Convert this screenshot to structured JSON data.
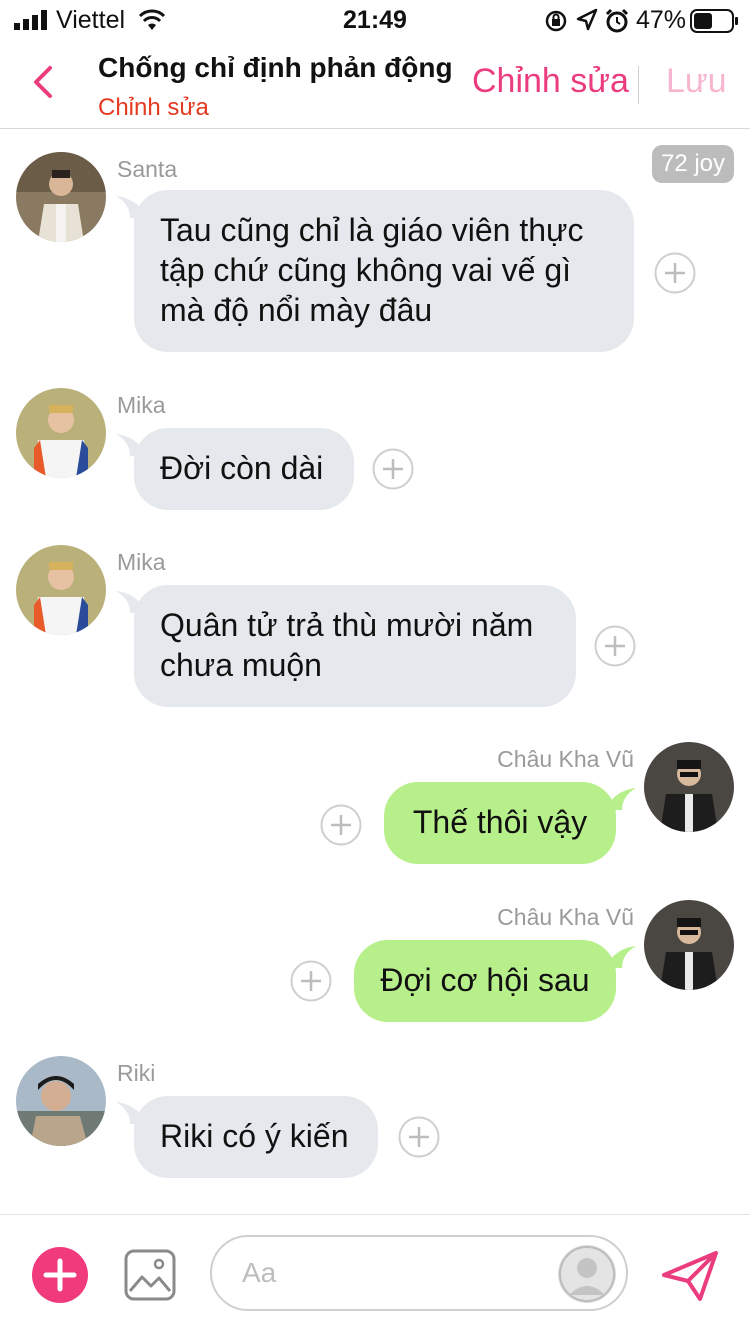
{
  "status_bar": {
    "carrier": "Viettel",
    "time": "21:49",
    "battery_percent": "47%"
  },
  "header": {
    "title": "Chống chỉ định phản động",
    "subtitle": "Chỉnh sửa",
    "edit_label": "Chỉnh sửa",
    "save_label": "Lưu"
  },
  "badge": "72 joy",
  "messages": [
    {
      "sender": "Santa",
      "text_lines": [
        "Tau cũng chỉ là giáo viên thực",
        "tập chứ cũng không vai vế gì",
        "mà độ nổi mày đâu"
      ],
      "direction": "in"
    },
    {
      "sender": "Mika",
      "text_lines": [
        "Đời còn dài"
      ],
      "direction": "in"
    },
    {
      "sender": "Mika",
      "text_lines": [
        "Quân tử trả thù mười năm",
        "chưa muộn"
      ],
      "direction": "in"
    },
    {
      "sender": "Châu Kha Vũ",
      "text_lines": [
        "Thế thôi vậy"
      ],
      "direction": "out"
    },
    {
      "sender": "Châu Kha Vũ",
      "text_lines": [
        "Đợi cơ hội sau"
      ],
      "direction": "out"
    },
    {
      "sender": "Riki",
      "text_lines": [
        "Riki có ý kiến"
      ],
      "direction": "in"
    }
  ],
  "composer": {
    "placeholder": "Aa"
  },
  "colors": {
    "accent": "#ea3c7e",
    "subtitle": "#e53a22",
    "bubble_in": "#e5e8ec",
    "bubble_out": "#b7ef8a"
  },
  "icons": {
    "back": "chevron-left-icon",
    "add": "plus-icon",
    "gallery": "image-icon",
    "send": "send-icon",
    "react": "plus-circle-icon"
  }
}
